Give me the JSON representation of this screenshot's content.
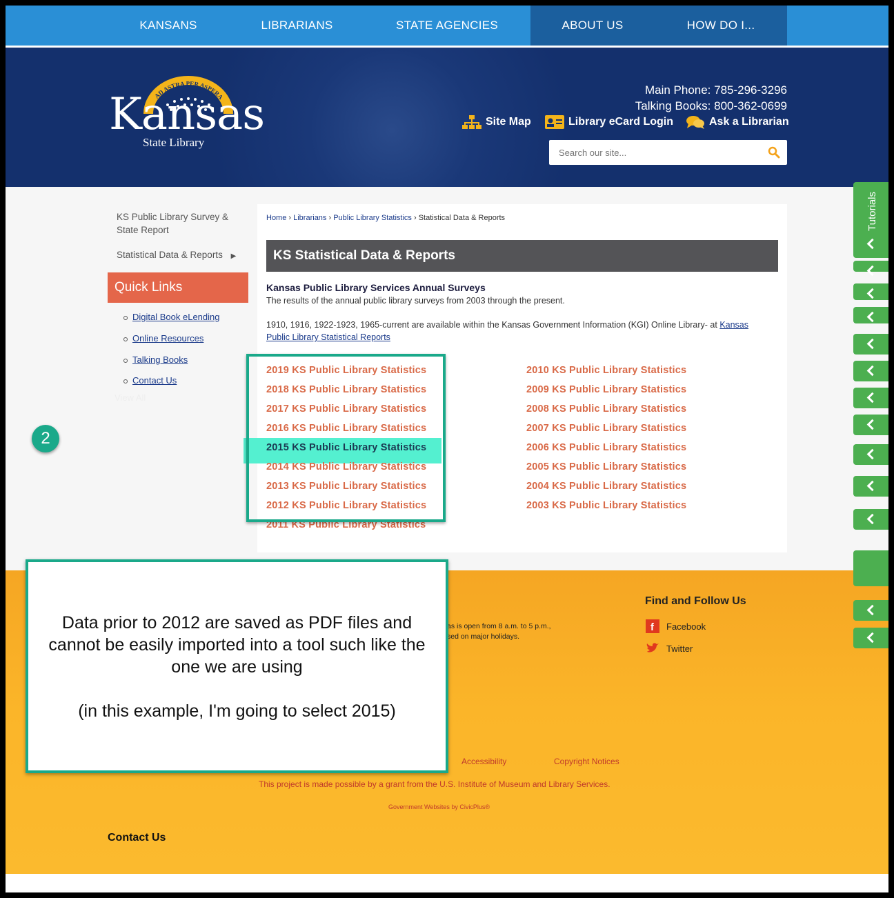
{
  "nav": {
    "items": [
      "KANSANS",
      "LIBRARIANS",
      "STATE AGENCIES",
      "ABOUT US",
      "HOW DO I..."
    ]
  },
  "header": {
    "logo_arc_text": "AD ASTRA PER ASPERA",
    "logo_word": "Kansas",
    "logo_sub": "State Library",
    "main_phone": "Main Phone: 785-296-3296",
    "talking_books": "Talking Books: 800-362-0699",
    "links": [
      "Site Map",
      "Library eCard Login",
      "Ask a Librarian"
    ],
    "search_placeholder": "Search our site..."
  },
  "sidebar": {
    "items": [
      "KS Public Library Survey & State Report",
      "Statistical Data & Reports"
    ],
    "quick_links_title": "Quick Links",
    "quick_links": [
      "Digital Book eLending",
      "Online Resources",
      "Talking Books",
      "Contact Us"
    ],
    "view_all": "View All"
  },
  "breadcrumb": [
    "Home",
    "Librarians",
    "Public Library Statistics",
    "Statistical Data & Reports"
  ],
  "page_title": "KS Statistical Data & Reports",
  "subheading": "Kansas Public Library Services Annual Surveys",
  "intro": "The results of the annual public library surveys from 2003 through the present.",
  "kgi_text": "1910, 1916, 1922-1923, 1965-current are available within the Kansas Government Information (KGI) Online Library- at ",
  "kgi_link": "Kansas Public Library Statistical Reports",
  "stats_left": [
    "2019 KS Public Library Statistics",
    "2018 KS Public Library Statistics",
    "2017 KS Public Library Statistics",
    "2016 KS Public Library Statistics",
    "2015 KS Public Library Statistics",
    "2014 KS Public Library Statistics",
    "2013 KS Public Library Statistics",
    "2012 KS Public Library Statistics",
    "2011 KS Public Library Statistics"
  ],
  "stats_right": [
    "2010 KS Public Library Statistics",
    "2009 KS Public Library Statistics",
    "2008 KS Public Library Statistics",
    "2007 KS Public Library Statistics",
    "2006 KS Public Library Statistics",
    "2005 KS Public Library Statistics",
    "2004 KS Public Library Statistics",
    "2003 KS Public Library Statistics"
  ],
  "tabs": {
    "label": "Tutorials"
  },
  "annotation": {
    "step": "2",
    "line1": "Data prior to 2012 are saved as PDF files and cannot be easily imported into a tool such like the one we are using",
    "line2": "(in this example, I'm going to select 2015)"
  },
  "footer": {
    "follow_title": "Find and Follow Us",
    "social": [
      "Facebook",
      "Twitter"
    ],
    "hours_1": "as is open from 8 a.m. to 5 p.m.,",
    "hours_2": "sed on major holidays.",
    "links": [
      "Accessibility",
      "Copyright Notices"
    ],
    "grant": "This project is made possible by a grant from the U.S. Institute of Museum and Library Services.",
    "civic": "Government Websites by CivicPlus®",
    "contact": "Contact Us"
  },
  "colors": {
    "nav": "#2a8fd6",
    "nav_active": "#1b5f9e",
    "header": "#14306d",
    "accent": "#e4664a",
    "stat_link": "#d96a48",
    "annotation": "#1aa98a",
    "footer": "#fbb529",
    "tab": "#4caf50"
  }
}
